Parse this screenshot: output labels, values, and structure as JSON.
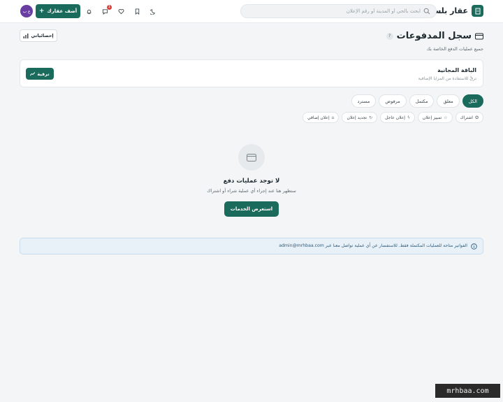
{
  "header": {
    "brand": "عقار بلس",
    "search_placeholder": "ابحث بالحي أو المدينة أو رقم الإعلان",
    "add_button": "أضف عقارك",
    "notification_count": "1",
    "avatar_initials": "ع ب",
    "icons": [
      "building-icon",
      "search-icon",
      "moon-icon",
      "bookmark-icon",
      "heart-icon",
      "chat-icon",
      "bell-icon",
      "plus-icon"
    ]
  },
  "page": {
    "title": "سجل المدفوعات",
    "help": "?",
    "subtitle": "جميع عمليات الدفع الخاصة بك",
    "stats_button": "إحصائياتي"
  },
  "plan": {
    "name": "الباقة المجانية",
    "description": "ترقَّ للاستفادة من المزايا الإضافية",
    "upgrade_button": "ترقية"
  },
  "status_tabs": [
    "الكل",
    "معلق",
    "مكتمل",
    "مرفوض",
    "مسترد"
  ],
  "active_tab": "الكل",
  "type_filters": [
    {
      "label": "اشتراك",
      "icon": "star-icon"
    },
    {
      "label": "تمييز إعلان",
      "icon": "star-icon"
    },
    {
      "label": "إعلان عاجل",
      "icon": "bolt-icon"
    },
    {
      "label": "تجديد إعلان",
      "icon": "refresh-icon"
    },
    {
      "label": "إعلان إضافي",
      "icon": "home-icon"
    }
  ],
  "empty_state": {
    "title": "لا توجد عمليات دفع",
    "description": "ستظهر هنا عند إجراء أي عملية شراء أو اشتراك",
    "button": "استعرض الخدمات"
  },
  "info_banner": {
    "text": "الفواتير متاحة للعمليات المكتملة فقط. للاستفسار عن أي عملية تواصل معنا عبر admin@mrhbaa.com"
  },
  "watermark": "mrhbaa.com"
}
